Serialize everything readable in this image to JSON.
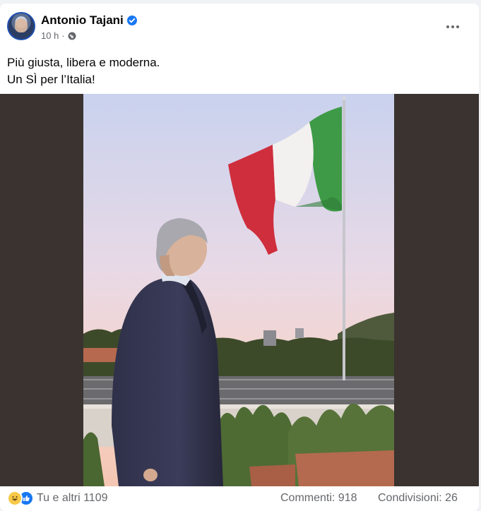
{
  "post": {
    "author": "Antonio Tajani",
    "time": "10 h",
    "separator": "·",
    "text_line1": "Più giusta, libera e moderna.",
    "text_line2": "Un SÌ per l’Italia!"
  },
  "footer": {
    "reactions_text": "Tu e altri 1109",
    "comments": "Commenti: 918",
    "shares": "Condivisioni: 26"
  },
  "icons": [
    "avatar",
    "verified-badge-icon",
    "globe-icon",
    "more-options-icon",
    "haha-reaction-icon",
    "like-reaction-icon"
  ],
  "colors": {
    "accent": "#1877f2",
    "secondary_text": "#65676b",
    "media_bg": "#3a3330"
  }
}
